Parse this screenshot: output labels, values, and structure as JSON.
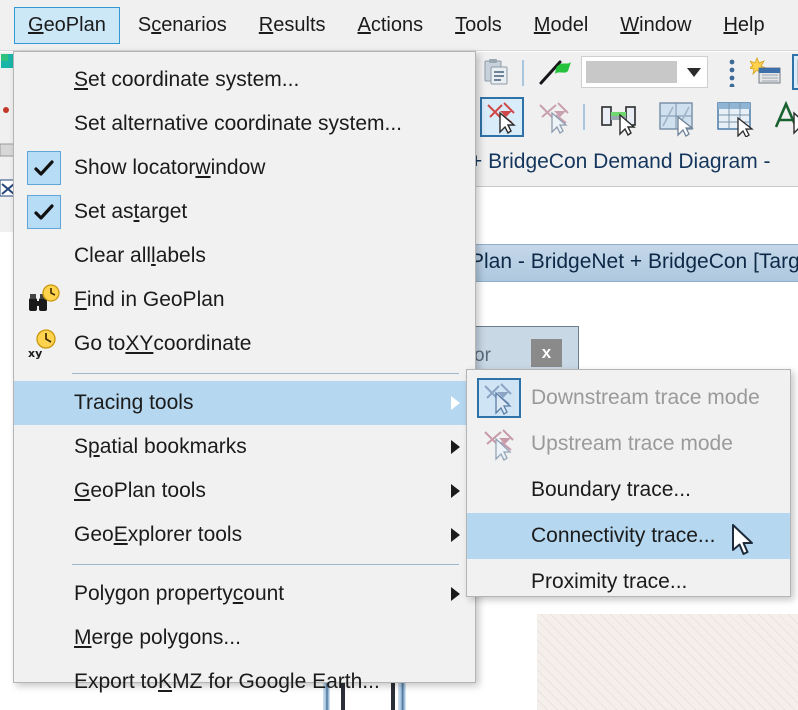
{
  "app": {
    "menubar": [
      {
        "id": "geoplan",
        "label": "GeoPlan",
        "pre": "G",
        "rest": "eoPlan",
        "active": true
      },
      {
        "id": "scenarios",
        "label": "Scenarios",
        "pre": "S",
        "mid": "c",
        "rest": "enarios",
        "active": false
      },
      {
        "id": "results",
        "label": "Results",
        "pre": "R",
        "rest": "esults",
        "active": false
      },
      {
        "id": "actions",
        "label": "Actions",
        "pre": "A",
        "rest": "ctions",
        "active": false
      },
      {
        "id": "tools",
        "label": "Tools",
        "pre": "T",
        "rest": "ools",
        "active": false
      },
      {
        "id": "model",
        "label": "Model",
        "pre": "M",
        "rest": "odel",
        "active": false
      },
      {
        "id": "window",
        "label": "Window",
        "pre": "W",
        "rest": "indow",
        "active": false
      },
      {
        "id": "help",
        "label": "Help",
        "pre": "H",
        "rest": "elp",
        "active": false
      }
    ],
    "tabstrip_text": "+ BridgeCon   Demand Diagram -",
    "mdi_title": "Plan - BridgeNet + BridgeCon [Targ",
    "float_panel": {
      "label": "or",
      "close_label": "x"
    },
    "toolbar_dropdown_value": ""
  },
  "menu_geoplan": {
    "title": "GeoPlan",
    "items": [
      {
        "id": "set-coordinate-system",
        "label": "Set coordinate system...",
        "kind": "item",
        "accel": "S",
        "icon": null,
        "checked": false,
        "submenu": false,
        "highlighted": false
      },
      {
        "id": "set-alternative-coordinate-system",
        "label": "Set alternative coordinate system...",
        "kind": "item",
        "accel": null,
        "icon": null,
        "checked": false,
        "submenu": false,
        "highlighted": false
      },
      {
        "id": "show-locator-window",
        "label": "Show locator window",
        "kind": "checkitem",
        "accel": "w",
        "icon": null,
        "checked": true,
        "submenu": false,
        "highlighted": false
      },
      {
        "id": "set-as-target",
        "label": "Set as target",
        "kind": "checkitem",
        "accel": "t",
        "icon": null,
        "checked": true,
        "submenu": false,
        "highlighted": false
      },
      {
        "id": "clear-all-labels",
        "label": "Clear all labels",
        "kind": "item",
        "accel": "l",
        "icon": null,
        "checked": false,
        "submenu": false,
        "highlighted": false
      },
      {
        "id": "find-in-geoplan",
        "label": "Find in GeoPlan",
        "kind": "item",
        "accel": "F",
        "icon": "binoculars-clock-icon",
        "checked": false,
        "submenu": false,
        "highlighted": false
      },
      {
        "id": "go-to-xy-coordinate",
        "label": "Go to XY coordinate",
        "kind": "item",
        "accel": "XY",
        "icon": "xy-clock-icon",
        "checked": false,
        "submenu": false,
        "highlighted": false
      },
      {
        "id": "separator-1",
        "kind": "separator"
      },
      {
        "id": "tracing-tools",
        "label": "Tracing tools",
        "kind": "item",
        "accel": null,
        "icon": null,
        "checked": false,
        "submenu": true,
        "highlighted": true
      },
      {
        "id": "spatial-bookmarks",
        "label": "Spatial bookmarks",
        "kind": "item",
        "accel": "p",
        "icon": null,
        "checked": false,
        "submenu": true,
        "highlighted": false
      },
      {
        "id": "geoplan-tools",
        "label": "GeoPlan tools",
        "kind": "item",
        "accel": "G",
        "icon": null,
        "checked": false,
        "submenu": true,
        "highlighted": false
      },
      {
        "id": "geoexplorer-tools",
        "label": "GeoExplorer tools",
        "kind": "item",
        "accel": "E",
        "icon": null,
        "checked": false,
        "submenu": true,
        "highlighted": false
      },
      {
        "id": "separator-2",
        "kind": "separator"
      },
      {
        "id": "polygon-property-count",
        "label": "Polygon property count",
        "kind": "item",
        "accel": "c",
        "icon": null,
        "checked": false,
        "submenu": true,
        "highlighted": false
      },
      {
        "id": "merge-polygons",
        "label": "Merge polygons...",
        "kind": "item",
        "accel": "M",
        "icon": null,
        "checked": false,
        "submenu": false,
        "highlighted": false
      },
      {
        "id": "export-to-kmz",
        "label": "Export to KMZ for Google Earth...",
        "kind": "item",
        "accel": "K",
        "icon": null,
        "checked": false,
        "submenu": false,
        "highlighted": false
      }
    ]
  },
  "menu_tracing_tools": {
    "title": "Tracing tools",
    "items": [
      {
        "id": "downstream-trace-mode",
        "label": "Downstream trace mode",
        "icon": "downstream-trace-icon",
        "disabled": true,
        "selected": true,
        "highlighted": false
      },
      {
        "id": "upstream-trace-mode",
        "label": "Upstream trace mode",
        "icon": "upstream-trace-icon",
        "disabled": true,
        "selected": false,
        "highlighted": false
      },
      {
        "id": "boundary-trace",
        "label": "Boundary trace...",
        "icon": null,
        "disabled": false,
        "selected": false,
        "highlighted": false
      },
      {
        "id": "connectivity-trace",
        "label": "Connectivity trace...",
        "icon": null,
        "disabled": false,
        "selected": false,
        "highlighted": true
      },
      {
        "id": "proximity-trace",
        "label": "Proximity trace...",
        "icon": null,
        "disabled": false,
        "selected": false,
        "highlighted": false
      }
    ]
  },
  "toolbars": {
    "row1": [
      {
        "id": "paste-icon",
        "name": "paste-icon"
      },
      {
        "id": "sep1",
        "name": "separator"
      },
      {
        "id": "flag-icon",
        "name": "green-flag-icon"
      },
      {
        "id": "dropdown",
        "name": "toolbar-combo"
      },
      {
        "id": "overflow",
        "name": "overflow-dots-icon"
      },
      {
        "id": "new-grid-icon",
        "name": "new-grid-icon"
      },
      {
        "id": "chart-icon",
        "name": "colored-chart-icon"
      }
    ],
    "row2": [
      {
        "id": "downstream-trace-tool",
        "name": "downstream-trace-icon",
        "selected": true
      },
      {
        "id": "upstream-trace-tool",
        "name": "upstream-trace-icon",
        "selected": false
      },
      {
        "id": "sep2",
        "name": "separator"
      },
      {
        "id": "link-tool",
        "name": "link-select-icon",
        "selected": false
      },
      {
        "id": "grid-select-tool",
        "name": "grid-select-icon",
        "selected": false
      },
      {
        "id": "table-select-tool",
        "name": "table-select-icon",
        "selected": false
      },
      {
        "id": "text-tool",
        "name": "text-annotation-icon",
        "selected": false
      },
      {
        "id": "sep3",
        "name": "separator"
      },
      {
        "id": "more-tool",
        "name": "more-tool-icon",
        "selected": false
      }
    ]
  },
  "colors": {
    "menu_bg": "#f1f1f1",
    "highlight": "#b5d7f0",
    "menubar_active_bg": "#cce8f7",
    "menubar_active_border": "#3399d4",
    "text": "#1b1b1b",
    "disabled_text": "#9a9a9a",
    "separator": "#9eb8cd",
    "title_text": "#0d2947",
    "hatch_bg": "#f5efeb"
  }
}
